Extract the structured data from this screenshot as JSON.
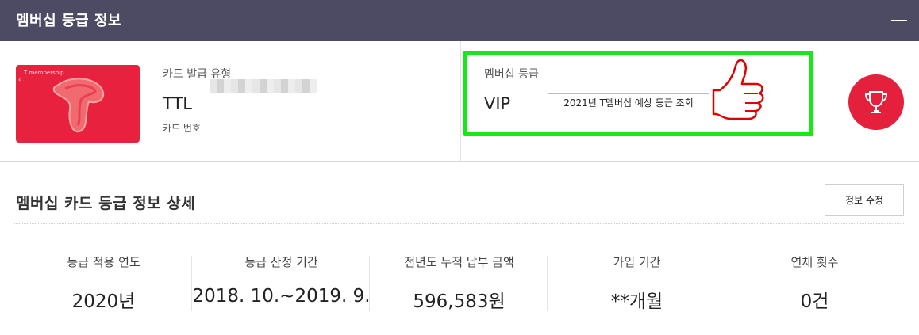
{
  "header": {
    "title": "멤버십 등급 정보",
    "collapse_icon": "minus-icon"
  },
  "card": {
    "image_label": "T membership",
    "issue_type_label": "카드 발급 유형",
    "issue_type_value": "TTL",
    "card_number_label": "카드 번호",
    "brand_color": "#e8213f"
  },
  "grade": {
    "label": "멤버십 등급",
    "value": "VIP",
    "predict_button": "2021년 T멤버십 예상 등급 조회",
    "highlight_color": "#17e817",
    "trophy_color": "#e5203c"
  },
  "detail": {
    "title": "멤버십 카드 등급 정보 상세",
    "edit_button": "정보 수정",
    "stats": [
      {
        "label": "등급 적용 연도",
        "value": "2020년"
      },
      {
        "label": "등급 산정 기간",
        "value": "2018. 10.~2019. 9."
      },
      {
        "label": "전년도 누적 납부 금액",
        "value": "596,583원"
      },
      {
        "label": "가입 기간",
        "value": "**개월"
      },
      {
        "label": "연체 횟수",
        "value": "0건"
      }
    ]
  }
}
